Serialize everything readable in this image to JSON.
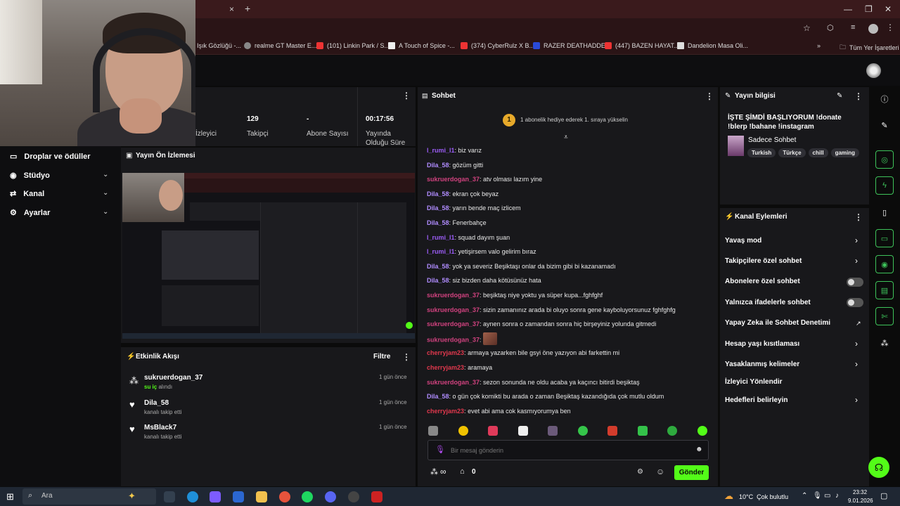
{
  "browser": {
    "bookmarks": [
      {
        "label": "Işık Gözlüğü -...",
        "icon": "page-icon"
      },
      {
        "label": "realme GT Master E...",
        "icon": "globe-icon"
      },
      {
        "label": "(101) Linkin Park / S...",
        "icon": "youtube-icon"
      },
      {
        "label": "A Touch of Spice -...",
        "icon": "page-icon"
      },
      {
        "label": "(374) CyberRulz X B...",
        "icon": "youtube-icon"
      },
      {
        "label": "RAZER DEATHADDE...",
        "icon": "vivaldi-icon"
      },
      {
        "label": "(447) BAZEN HAYAT...",
        "icon": "youtube-icon"
      },
      {
        "label": "Dandelion Masa Oli...",
        "icon": "page-icon"
      }
    ],
    "all_bookmarks_label": "Tüm Yer İşaretleri",
    "more_bookmarks": "»",
    "new_tab": "+",
    "close_tab": "×"
  },
  "stats": [
    {
      "value": "",
      "label": "İzleyici"
    },
    {
      "value": "129",
      "label": "Takipçi"
    },
    {
      "value": "-",
      "label": "Abone Sayısı"
    },
    {
      "value": "00:17:56",
      "label": "Yayında Olduğu Süre"
    }
  ],
  "nav": {
    "items": [
      {
        "label": "Droplar ve ödüller",
        "has_chevron": false
      },
      {
        "label": "Stüdyo",
        "has_chevron": true
      },
      {
        "label": "Kanal",
        "has_chevron": true
      },
      {
        "label": "Ayarlar",
        "has_chevron": true
      }
    ]
  },
  "preview": {
    "title": "Yayın Ön İzlemesi"
  },
  "activity": {
    "title": "Etkinlik Akışı",
    "filter_label": "Filtre",
    "items": [
      {
        "user": "sukruerdogan_37",
        "highlight": "su iç",
        "action": "alındı",
        "time": "1 gün önce",
        "icon": "gift-icon"
      },
      {
        "user": "Dila_58",
        "highlight": "",
        "action": "kanalı takip etti",
        "time": "1 gün önce",
        "icon": "heart-icon"
      },
      {
        "user": "MsBlack7",
        "highlight": "",
        "action": "kanalı takip etti",
        "time": "1 gün önce",
        "icon": "heart-icon"
      }
    ]
  },
  "chat": {
    "title": "Sohbet",
    "banner": "1 abonelik hediye ederek 1. sıraya yükselin",
    "banner_badge": "1",
    "messages": [
      {
        "user": "l_rumi_l1",
        "text": "biz varız",
        "color": "#9b5cf6"
      },
      {
        "user": "Dila_58",
        "text": "gözüm gitti",
        "color": "#b08cff"
      },
      {
        "user": "sukruerdogan_37",
        "text": "atv olması lazım yine",
        "color": "#d1427f"
      },
      {
        "user": "Dila_58",
        "text": "ekran çok beyaz",
        "color": "#b08cff"
      },
      {
        "user": "Dila_58",
        "text": "yarın bende maç izlicem",
        "color": "#b08cff"
      },
      {
        "user": "Dila_58",
        "text": "Fenerbahçe",
        "color": "#b08cff"
      },
      {
        "user": "l_rumi_l1",
        "text": "squad dayım şuan",
        "color": "#9b5cf6"
      },
      {
        "user": "l_rumi_l1",
        "text": "yetişirsem valo gelirim bıraz",
        "color": "#9b5cf6"
      },
      {
        "user": "Dila_58",
        "text": "yok ya severiz Beşiktaşı onlar da bizim gibi bi kazanamadı",
        "color": "#b08cff"
      },
      {
        "user": "Dila_58",
        "text": "siz bizden daha kötüsünüz hata",
        "color": "#b08cff"
      },
      {
        "user": "sukruerdogan_37",
        "text": "beşiktaş niye yoktu ya süper kupa...fghfghf",
        "color": "#d1427f"
      },
      {
        "user": "sukruerdogan_37",
        "text": "sizin zamanınız arada bi oluyo sonra gene kayboluyorsunuz fghfghfg",
        "color": "#d1427f"
      },
      {
        "user": "sukruerdogan_37",
        "text": "aynen sonra o zamandan sonra hiç birşeyiniz yolunda gitmedi",
        "color": "#d1427f"
      },
      {
        "user": "sukruerdogan_37",
        "text": "",
        "color": "#d1427f",
        "emote": true
      },
      {
        "user": "cherryjam23",
        "text": "armaya yazarken bile gsyi öne yazıyon abi farkettin mi",
        "color": "#e0384d"
      },
      {
        "user": "cherryjam23",
        "text": "aramaya",
        "color": "#e0384d"
      },
      {
        "user": "sukruerdogan_37",
        "text": "sezon sonunda ne oldu acaba ya kaçıncı bitirdi beşiktaş",
        "color": "#d1427f"
      },
      {
        "user": "Dila_58",
        "text": "o gün çok komikti bu arada o zaman Beşiktaş kazandığıda çok mutlu oldum",
        "color": "#b08cff"
      },
      {
        "user": "cherryjam23",
        "text": "evet abi ama cok kasmıyorumya ben",
        "color": "#e0384d"
      }
    ],
    "input_placeholder": "Bir mesaj gönderin",
    "infinity_label": "∞",
    "points": "0",
    "send_label": "Gönder"
  },
  "stream_info": {
    "title_label": "Yayın bilgisi",
    "stream_title": "İŞTE ŞİMDİ BAŞLIYORUM !donate !blerp !bahane !instagram",
    "category": "Sadece Sohbet",
    "tags": [
      "Turkish",
      "Türkçe",
      "chill",
      "gaming"
    ]
  },
  "channel_actions": {
    "title": "Kanal Eylemleri",
    "items": [
      {
        "label": "Yavaş mod",
        "control": "chevron"
      },
      {
        "label": "Takipçilere özel sohbet",
        "control": "chevron"
      },
      {
        "label": "Abonelere özel sohbet",
        "control": "toggle"
      },
      {
        "label": "Yalnızca ifadelerle sohbet",
        "control": "toggle"
      },
      {
        "label": "Yapay Zeka ile Sohbet Denetimi",
        "control": "external"
      },
      {
        "label": "Hesap yaşı kısıtlaması",
        "control": "chevron"
      },
      {
        "label": "Yasaklanmış kelimeler",
        "control": "chevron"
      },
      {
        "label": "İzleyici Yönlendir",
        "control": "none"
      },
      {
        "label": "Hedefleri belirleyin",
        "control": "chevron"
      }
    ]
  },
  "taskbar": {
    "search_placeholder": "Ara",
    "weather": "10°C  Çok bulutlu",
    "time": "23:32",
    "date": "9.01.2026"
  },
  "colors": {
    "accent_green": "#53fc18",
    "panel_bg": "#18181b",
    "page_bg": "#0b0b0b"
  }
}
